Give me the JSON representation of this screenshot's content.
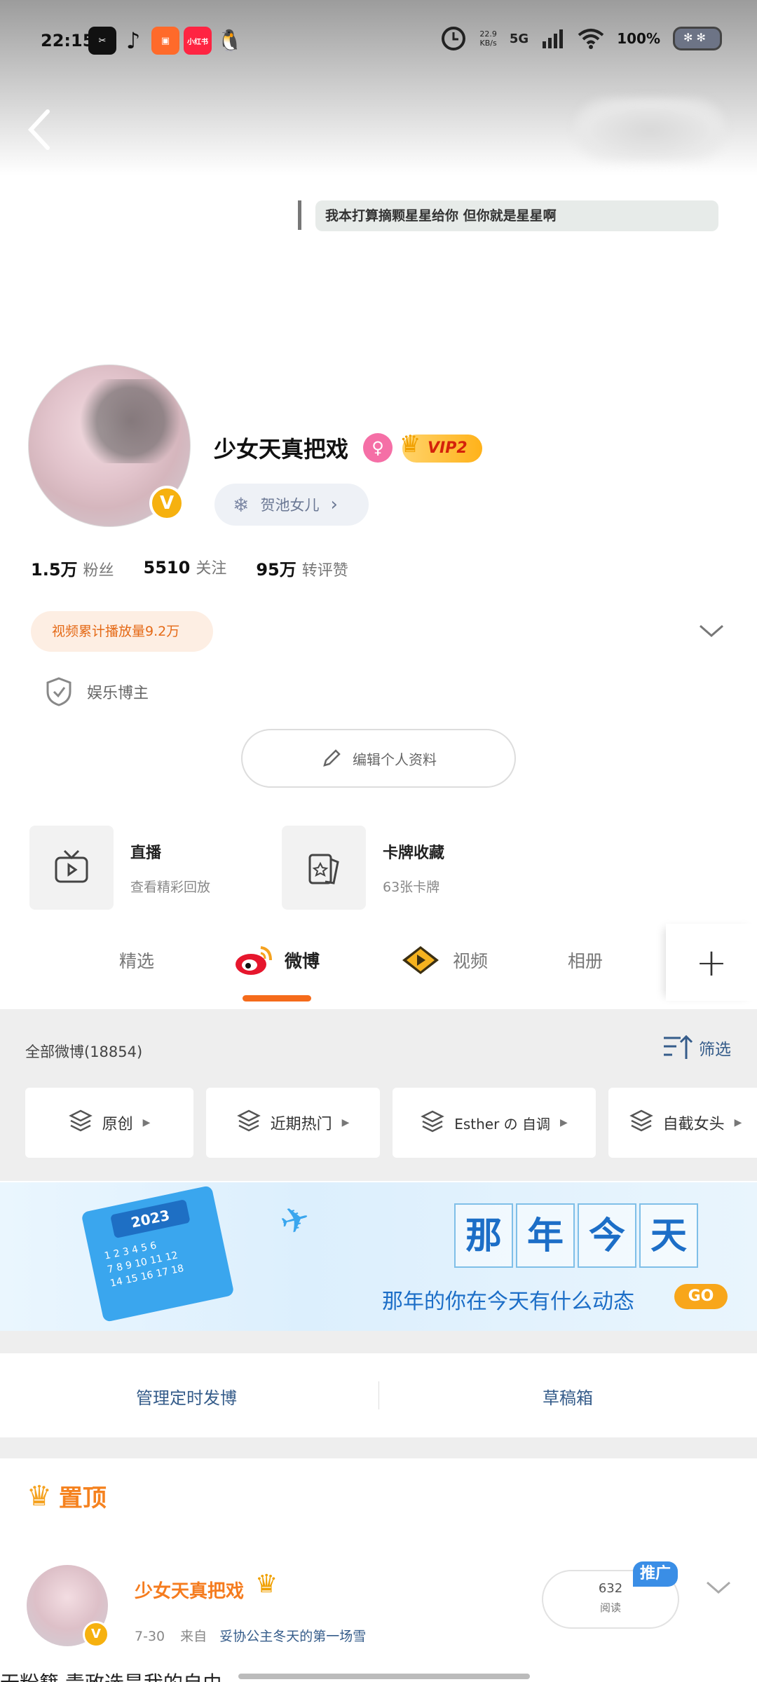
{
  "status_bar": {
    "time": "22:15",
    "net_speed_value": "22.9",
    "net_speed_unit": "KB/s",
    "network": "5G",
    "battery": "100%",
    "apps": [
      {
        "icon": "capcut-icon",
        "color": "#111111",
        "label": "✂"
      },
      {
        "icon": "tiktok-icon",
        "color": "#ffffff",
        "label": "♪"
      },
      {
        "icon": "kuaishou-icon",
        "color": "#ff6a2a",
        "label": "▣"
      },
      {
        "icon": "xiaohongshu-icon",
        "color": "#ff2442",
        "label": "小红书"
      },
      {
        "icon": "qq-icon",
        "color": "#ffffff",
        "label": "🐧"
      }
    ]
  },
  "profile": {
    "signature": "我本打算摘颗星星给你  但你就是星星啊",
    "username": "少女天真把戏",
    "female_symbol": "♀",
    "vip_label": "VIP2",
    "verified_mark": "V",
    "group_chip": "贺池女儿",
    "stats": [
      {
        "value": "1.5万",
        "label": "粉丝"
      },
      {
        "value": "5510",
        "label": "关注"
      },
      {
        "value": "95万",
        "label": "转评赞"
      }
    ],
    "video_plays": "视频累计播放量9.2万",
    "tag": "娱乐博主",
    "edit_button": "编辑个人资料"
  },
  "features": [
    {
      "title": "直播",
      "subtitle": "查看精彩回放",
      "icon": "tv-icon"
    },
    {
      "title": "卡牌收藏",
      "subtitle": "63张卡牌",
      "icon": "card-icon"
    }
  ],
  "tabs": {
    "items": [
      {
        "label": "精选"
      },
      {
        "label": "微博"
      },
      {
        "label": "视频"
      },
      {
        "label": "相册"
      }
    ],
    "active": "微博",
    "accent": "#f56b1b"
  },
  "feed_filter": {
    "all_label": "全部微博(18854)",
    "filter_label": "筛选",
    "categories": [
      "原创",
      "近期热门",
      "Esther の 自调",
      "自截女头"
    ]
  },
  "banner": {
    "calendar_year": "2023",
    "chars": [
      "那",
      "年",
      "今",
      "天"
    ],
    "subtitle": "那年的你在今天有什么动态",
    "go_label": "GO"
  },
  "manage": {
    "scheduled": "管理定时发博",
    "drafts": "草稿箱"
  },
  "pinned": {
    "label": "置顶",
    "post": {
      "author": "少女天真把戏",
      "date": "7-30",
      "source_prefix": "来自",
      "source": "妥协公主冬天的第一场雪",
      "read_count": "632",
      "read_label": "阅读",
      "promo_label": "推广",
      "text_preview": "无粉籍   青政选是我的自由"
    }
  }
}
